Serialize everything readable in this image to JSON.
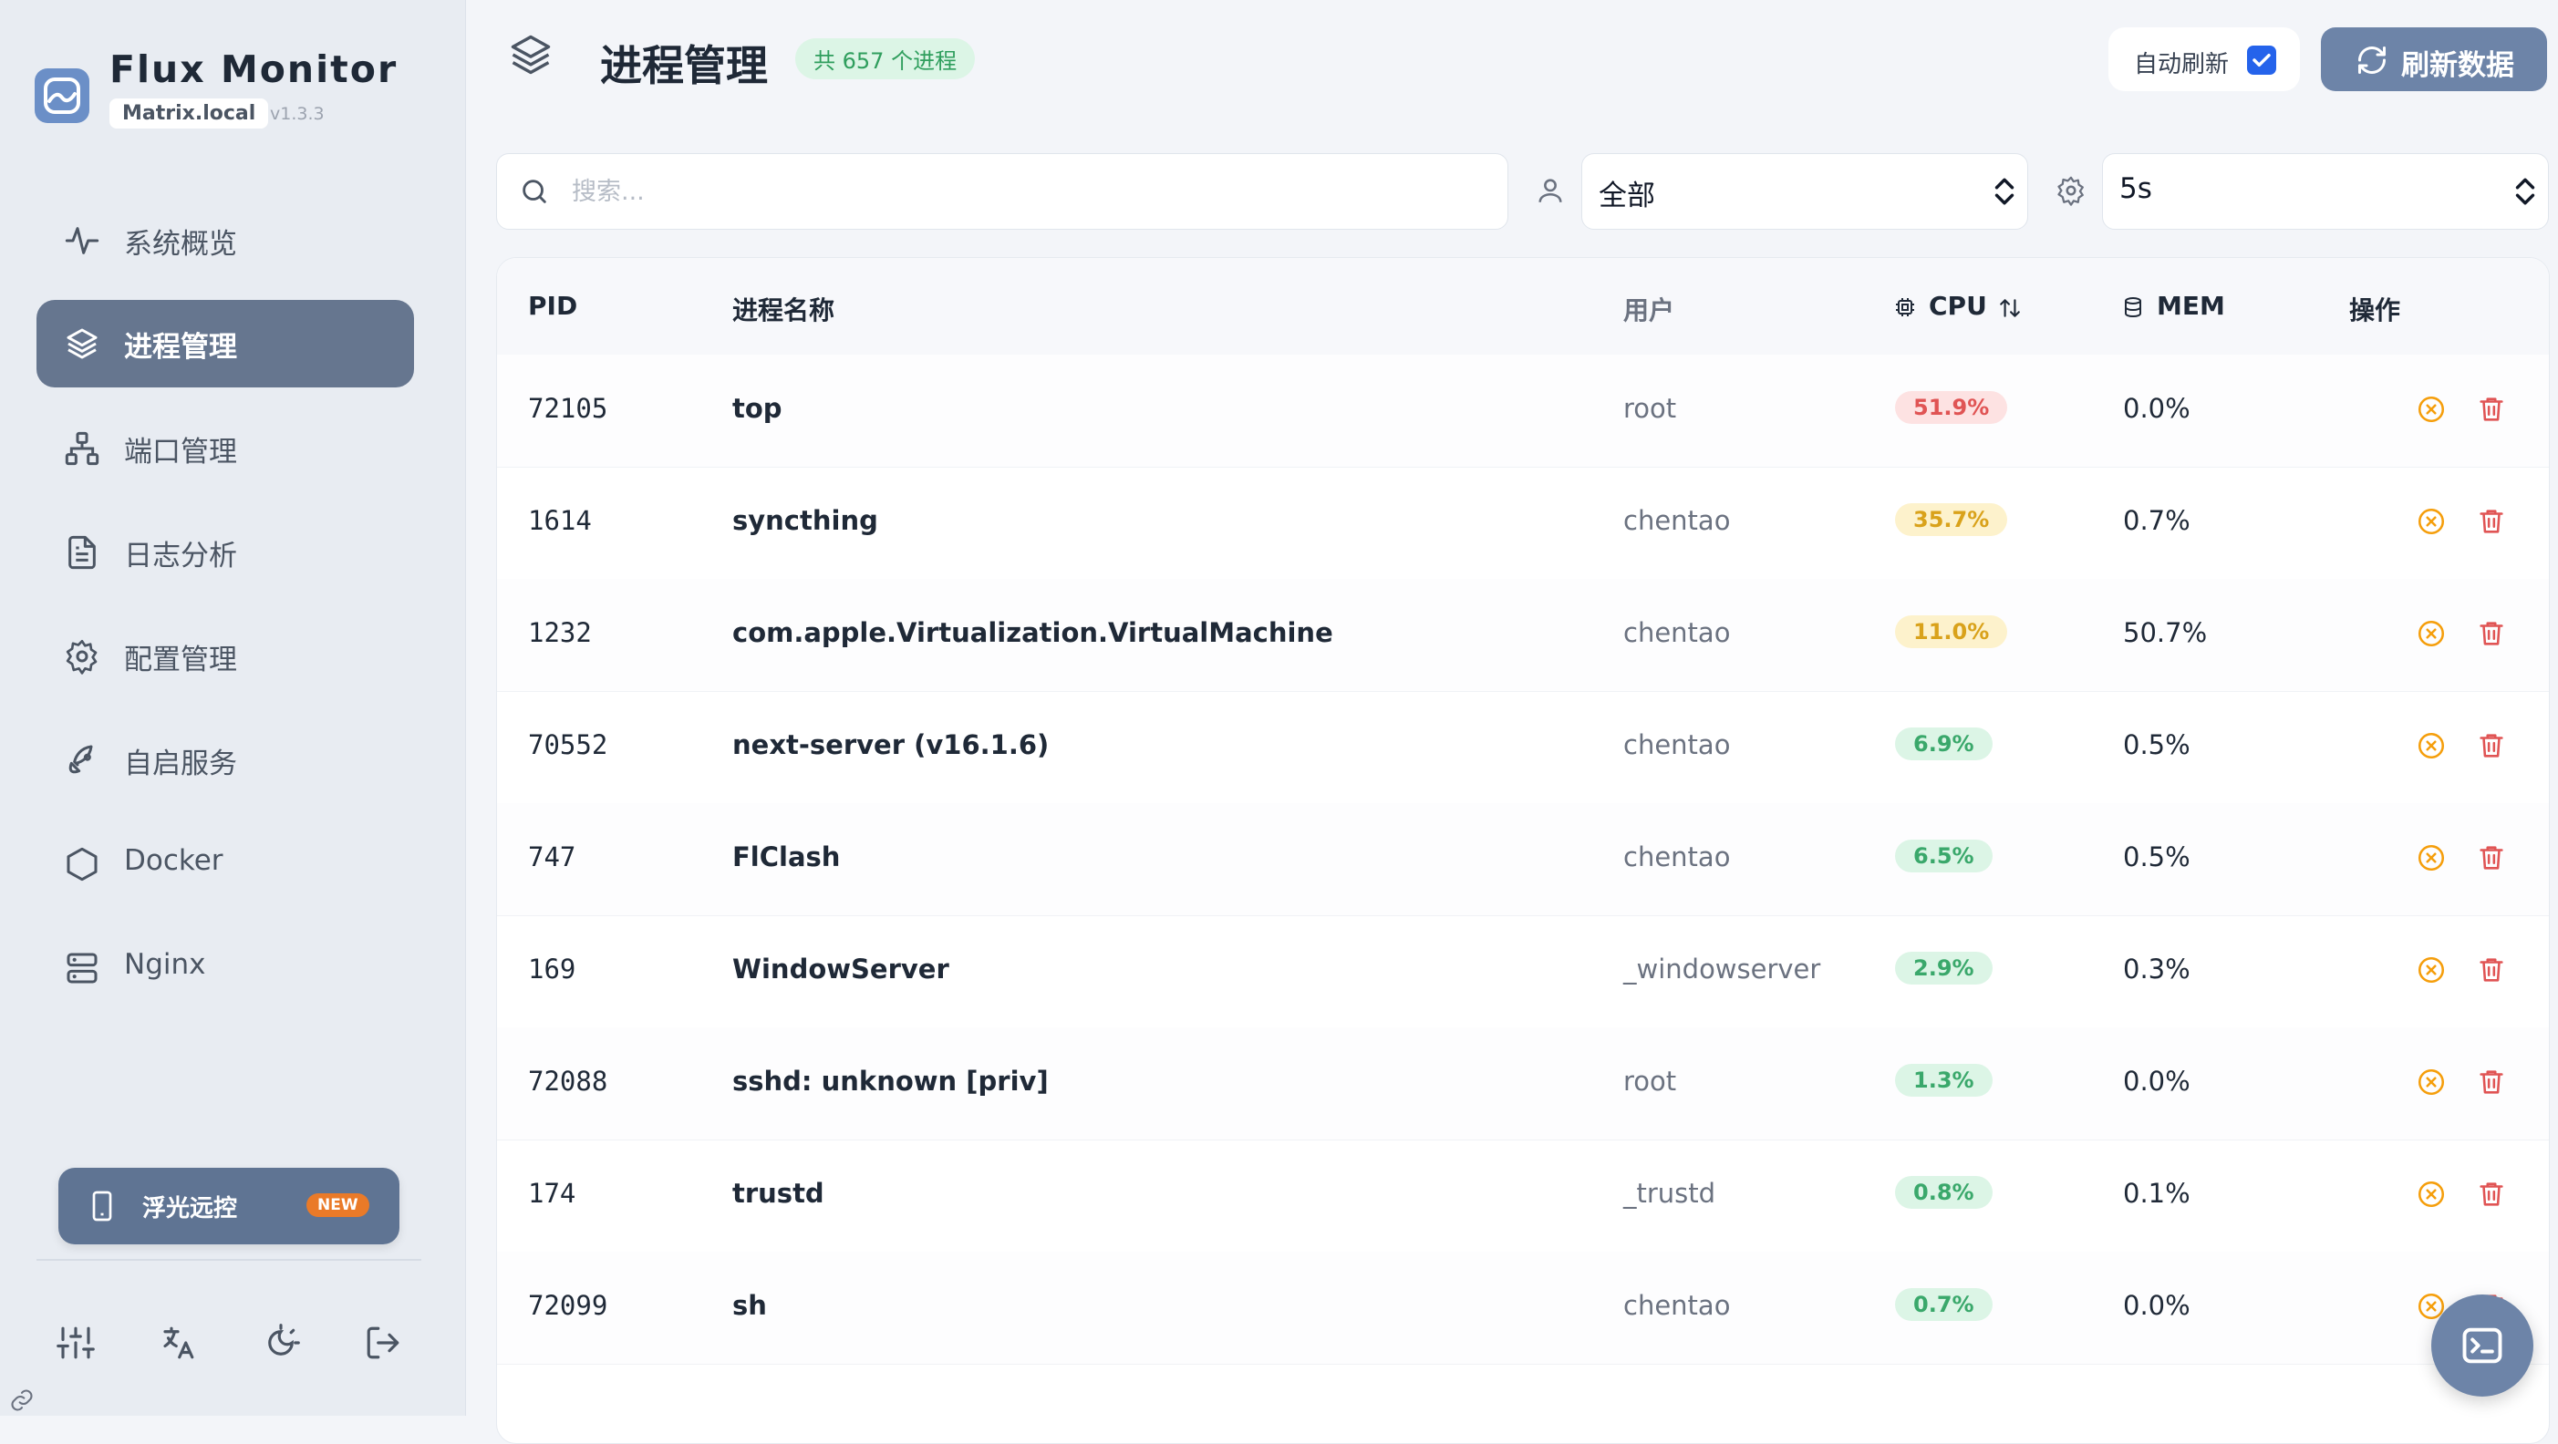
{
  "app": {
    "name": "Flux Monitor",
    "host": "Matrix.local",
    "version": "v1.3.3"
  },
  "sidebar": {
    "items": [
      {
        "label": "系统概览",
        "icon": "activity-icon",
        "active": false
      },
      {
        "label": "进程管理",
        "icon": "layers-icon",
        "active": true
      },
      {
        "label": "端口管理",
        "icon": "network-icon",
        "active": false
      },
      {
        "label": "日志分析",
        "icon": "file-text-icon",
        "active": false
      },
      {
        "label": "配置管理",
        "icon": "gear-icon",
        "active": false
      },
      {
        "label": "自启服务",
        "icon": "rocket-icon",
        "active": false
      },
      {
        "label": "Docker",
        "icon": "hexagon-icon",
        "active": false
      },
      {
        "label": "Nginx",
        "icon": "server-icon",
        "active": false
      }
    ],
    "promo": {
      "label": "浮光远控",
      "badge": "NEW"
    },
    "footer_icons": [
      "sliders-icon",
      "translate-icon",
      "theme-toggle-icon",
      "logout-icon"
    ]
  },
  "header": {
    "title": "进程管理",
    "count_badge": "共 657 个进程",
    "auto_refresh_label": "自动刷新",
    "auto_refresh_checked": true,
    "refresh_button": "刷新数据"
  },
  "filters": {
    "search_placeholder": "搜索...",
    "user_filter": "全部",
    "interval": "5s"
  },
  "table": {
    "columns": {
      "pid": "PID",
      "name": "进程名称",
      "user": "用户",
      "cpu": "CPU",
      "mem": "MEM",
      "actions": "操作"
    },
    "rows": [
      {
        "pid": "72105",
        "name": "top",
        "user": "root",
        "cpu": "51.9%",
        "cpu_level": "high",
        "mem": "0.0%"
      },
      {
        "pid": "1614",
        "name": "syncthing",
        "user": "chentao",
        "cpu": "35.7%",
        "cpu_level": "mid",
        "mem": "0.7%"
      },
      {
        "pid": "1232",
        "name": "com.apple.Virtualization.VirtualMachine",
        "user": "chentao",
        "cpu": "11.0%",
        "cpu_level": "mid",
        "mem": "50.7%"
      },
      {
        "pid": "70552",
        "name": "next-server (v16.1.6)",
        "user": "chentao",
        "cpu": "6.9%",
        "cpu_level": "low",
        "mem": "0.5%"
      },
      {
        "pid": "747",
        "name": "FlClash",
        "user": "chentao",
        "cpu": "6.5%",
        "cpu_level": "low",
        "mem": "0.5%"
      },
      {
        "pid": "169",
        "name": "WindowServer",
        "user": "_windowserver",
        "cpu": "2.9%",
        "cpu_level": "low",
        "mem": "0.3%"
      },
      {
        "pid": "72088",
        "name": "sshd: unknown [priv]",
        "user": "root",
        "cpu": "1.3%",
        "cpu_level": "low",
        "mem": "0.0%"
      },
      {
        "pid": "174",
        "name": "trustd",
        "user": "_trustd",
        "cpu": "0.8%",
        "cpu_level": "low",
        "mem": "0.1%"
      },
      {
        "pid": "72099",
        "name": "sh",
        "user": "chentao",
        "cpu": "0.7%",
        "cpu_level": "low",
        "mem": "0.0%"
      }
    ]
  },
  "colors": {
    "accent": "#6d84a8",
    "active_nav": "#66768f",
    "danger": "#e05454",
    "warning": "#d9a21b",
    "success": "#3aa86b",
    "kill_icon": "#f59e0b"
  }
}
